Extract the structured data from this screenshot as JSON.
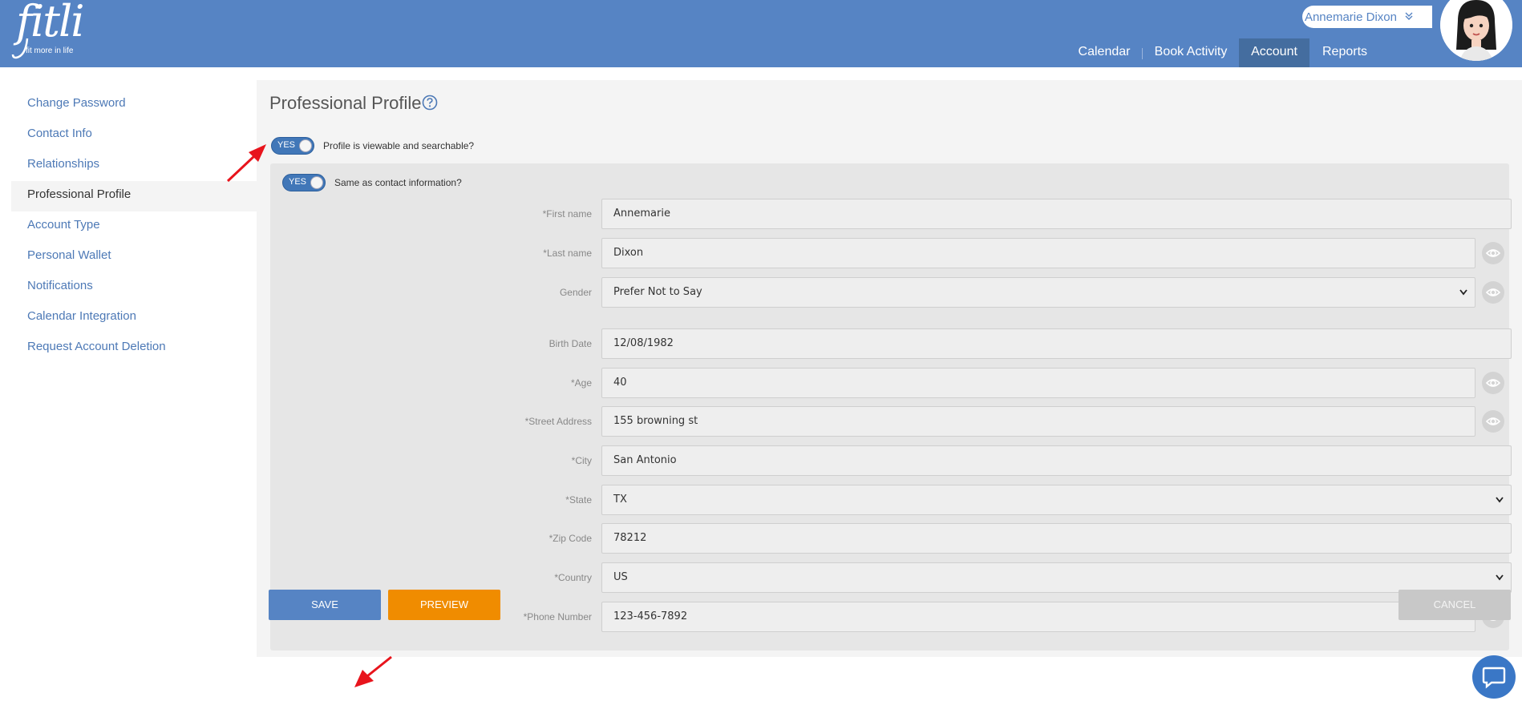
{
  "brand": {
    "logo_text": "fitli",
    "tagline": "fit more in life"
  },
  "user": {
    "name": "Annemarie Dixon"
  },
  "nav": {
    "items": [
      {
        "label": "Calendar"
      },
      {
        "label": "Book Activity"
      },
      {
        "label": "Account"
      },
      {
        "label": "Reports"
      }
    ],
    "active": "Account"
  },
  "sidebar": {
    "items": [
      {
        "label": "Change Password"
      },
      {
        "label": "Contact Info"
      },
      {
        "label": "Relationships"
      },
      {
        "label": "Professional Profile"
      },
      {
        "label": "Account Type"
      },
      {
        "label": "Personal Wallet"
      },
      {
        "label": "Notifications"
      },
      {
        "label": "Calendar Integration"
      },
      {
        "label": "Request Account Deletion"
      }
    ],
    "active": "Professional Profile"
  },
  "page": {
    "title": "Professional Profile",
    "toggle_viewable": {
      "state": "YES",
      "label": "Profile is viewable and searchable?"
    },
    "toggle_same": {
      "state": "YES",
      "label": "Same as contact information?"
    }
  },
  "form": {
    "first_name": {
      "label": "*First name",
      "value": "Annemarie"
    },
    "last_name": {
      "label": "*Last name",
      "value": "Dixon"
    },
    "gender": {
      "label": "Gender",
      "value": "Prefer Not to Say"
    },
    "birth_date": {
      "label": "Birth Date",
      "value": "12/08/1982"
    },
    "age": {
      "label": "*Age",
      "value": "40"
    },
    "street": {
      "label": "*Street Address",
      "value": "155 browning st"
    },
    "city": {
      "label": "*City",
      "value": "San Antonio"
    },
    "state": {
      "label": "*State",
      "value": "TX"
    },
    "zip": {
      "label": "*Zip Code",
      "value": "78212"
    },
    "country": {
      "label": "*Country",
      "value": "US"
    },
    "phone": {
      "label": "*Phone Number",
      "value": "123-456-7892"
    }
  },
  "actions": {
    "save": "SAVE",
    "preview": "PREVIEW",
    "cancel": "CANCEL"
  },
  "colors": {
    "header": "#5684c4",
    "nav_active": "#446d9f",
    "save": "#5684c4",
    "preview": "#f08c00",
    "cancel": "#c8c8c8",
    "annotation_arrow": "#e8141c"
  },
  "icons": [
    "help-icon",
    "eye-icon",
    "chevron-down-icon",
    "chat-icon",
    "arrow-annotation"
  ]
}
